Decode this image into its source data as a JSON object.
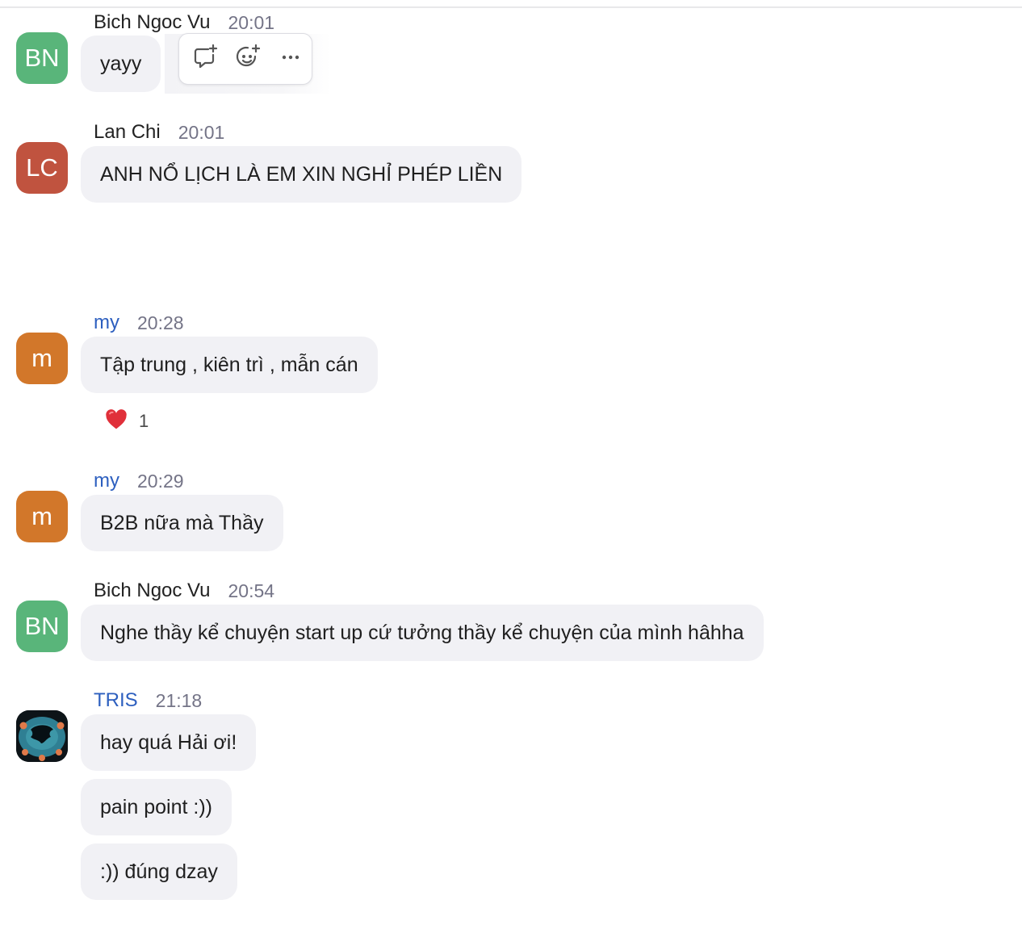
{
  "colors": {
    "avatar_bn": "#59b57a",
    "avatar_lc": "#c0533f",
    "avatar_my": "#d2772a",
    "bubble_bg": "#f1f1f5",
    "link_name": "#2d5fbf",
    "timestamp": "#747487"
  },
  "hover_toolbar": {
    "icons": [
      "reply-in-thread-icon",
      "add-reaction-icon",
      "more-options-icon"
    ]
  },
  "messages": [
    {
      "avatar_initials": "BN",
      "sender": "Bich Ngoc Vu",
      "time": "20:01",
      "bubbles": [
        "yayy"
      ]
    },
    {
      "avatar_initials": "LC",
      "sender": "Lan Chi",
      "time": "20:01",
      "bubbles": [
        "ANH NỔ LỊCH LÀ EM XIN NGHỈ PHÉP LIỀN"
      ]
    },
    {
      "avatar_initials": "m",
      "sender": "my",
      "time": "20:28",
      "bubbles": [
        "Tập trung , kiên trì , mẫn cán"
      ],
      "reaction": {
        "emoji": "❤️",
        "count": "1"
      }
    },
    {
      "avatar_initials": "m",
      "sender": "my",
      "time": "20:29",
      "bubbles": [
        "B2B nữa mà Thầy"
      ]
    },
    {
      "avatar_initials": "BN",
      "sender": "Bich Ngoc Vu",
      "time": "20:54",
      "bubbles": [
        "Nghe thầy kể chuyện start up cứ tưởng thầy kể chuyện của mình hâhha"
      ]
    },
    {
      "avatar_initials": "",
      "sender": "TRIS",
      "time": "21:18",
      "bubbles": [
        "hay quá Hải ơi!",
        "pain point :))",
        ":)) đúng dzay"
      ]
    }
  ]
}
